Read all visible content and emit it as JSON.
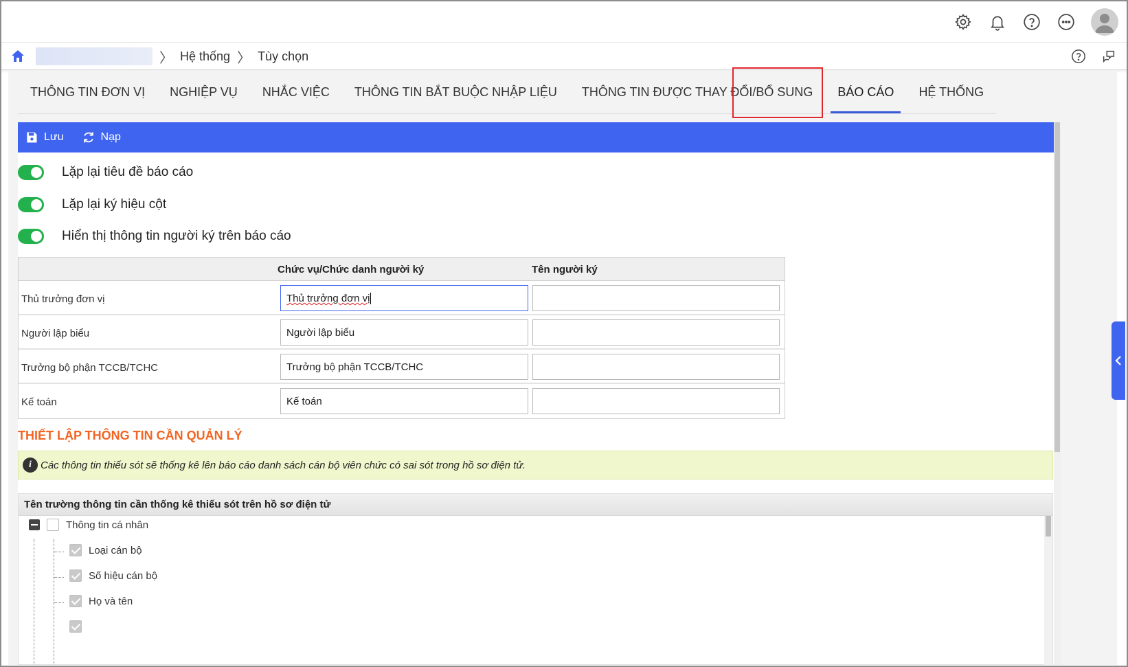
{
  "header": {
    "icons": [
      "gear-icon",
      "bell-icon",
      "help-icon",
      "more-icon",
      "avatar-icon"
    ]
  },
  "breadcrumb": {
    "items": [
      "Hệ thống",
      "Tùy chọn"
    ],
    "right_icons": [
      "help-icon",
      "feedback-icon"
    ]
  },
  "tabs": [
    {
      "label": "THÔNG TIN ĐƠN VỊ"
    },
    {
      "label": "NGHIỆP VỤ"
    },
    {
      "label": "NHẮC VIỆC"
    },
    {
      "label": "THÔNG TIN BẮT BUỘC NHẬP LIỆU"
    },
    {
      "label": "THÔNG TIN ĐƯỢC THAY ĐỔI/BỔ SUNG"
    },
    {
      "label": "BÁO CÁO"
    },
    {
      "label": "HỆ THỐNG"
    }
  ],
  "active_tab": "BÁO CÁO",
  "toolbar": {
    "save_label": "Lưu",
    "reload_label": "Nạp",
    "color": "#3f64f0"
  },
  "toggles": [
    {
      "label": "Lặp lại tiêu đề báo cáo",
      "on": true
    },
    {
      "label": "Lặp lại ký hiệu cột",
      "on": true
    },
    {
      "label": "Hiển thị thông tin người ký trên báo cáo",
      "on": true
    }
  ],
  "signer_table": {
    "col_title": "Chức vụ/Chức danh người ký",
    "col_name": "Tên người ký",
    "rows": [
      {
        "label": "Thủ trưởng đơn vị",
        "title": "Thủ trưởng đơn vị",
        "name": ""
      },
      {
        "label": "Người lập biểu",
        "title": "Người lập biểu",
        "name": ""
      },
      {
        "label": "Trưởng bộ phận TCCB/TCHC",
        "title": "Trưởng bộ phận TCCB/TCHC",
        "name": ""
      },
      {
        "label": "Kế toán",
        "title": "Kế toán",
        "name": ""
      }
    ]
  },
  "section": {
    "title": "THIẾT LẬP THÔNG TIN CẦN QUẢN LÝ",
    "info": "Các thông tin thiếu sót sẽ thống kê lên báo cáo danh sách cán bộ viên chức có sai sót trong hồ sơ điện tử.",
    "tree_header": "Tên trường thông tin cần thống kê thiếu sót trên hồ sơ điện tử",
    "tree": {
      "root": {
        "label": "Thông tin cá nhân",
        "checked": false
      },
      "children": [
        {
          "label": "Loại cán bộ",
          "checked": true
        },
        {
          "label": "Số hiệu cán bộ",
          "checked": true
        },
        {
          "label": "Họ và tên",
          "checked": true
        }
      ]
    }
  },
  "colors": {
    "accent": "#3f64f0",
    "toggle_on": "#22b14c",
    "section_title": "#f26522",
    "highlight": "#e0282d"
  }
}
